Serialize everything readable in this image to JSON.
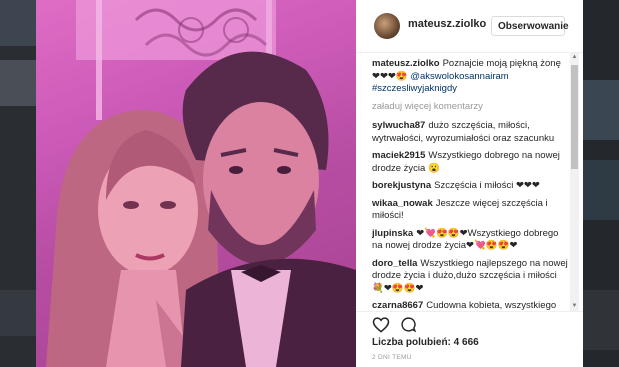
{
  "post": {
    "username": "mateusz.ziolko",
    "follow_label": "Obserwowanie",
    "caption_text": "Poznajcie moją piękną żonę ❤❤❤😍",
    "caption_mention": "@akswolokosannairam",
    "caption_hashtag": "#szczesliwyjaknigdy",
    "load_more_label": "załaduj więcej komentarzy",
    "likes_label": "Liczba polubień: 4 666",
    "time_ago": "2 DNI TEMU"
  },
  "comments": [
    {
      "user": "sylwucha87",
      "text": "dużo szczęścia, miłości, wytrwałości, wyrozumiałości oraz szacunku"
    },
    {
      "user": "maciek2915",
      "text": "Wszystkiego dobrego na nowej drodze życia 😮"
    },
    {
      "user": "borekjustyna",
      "text": "Szczęścia i miłości ❤❤❤"
    },
    {
      "user": "wikaa_nowak",
      "text": "Jeszcze więcej szczęścia i miłości!"
    },
    {
      "user": "jlupinska",
      "text": "❤💘😍😍❤Wszystkiego dobrego na nowej drodze życia❤💘😍😍❤"
    },
    {
      "user": "doro_tella",
      "text": "Wszystkiego najlepszego na nowej drodze życia i dużo,dużo szczęścia i miłości 💐❤😍😍❤"
    },
    {
      "user": "czarna8667",
      "text": "Cudowna kobieta, wszystkiego najlepszego na nowej drodze życia!!!:)"
    }
  ],
  "colors": {
    "link": "#003569",
    "text": "#262626",
    "muted": "#999999",
    "photo_tint": "#c85ab8"
  },
  "icons": {
    "like": "heart-icon",
    "comment": "comment-icon"
  }
}
